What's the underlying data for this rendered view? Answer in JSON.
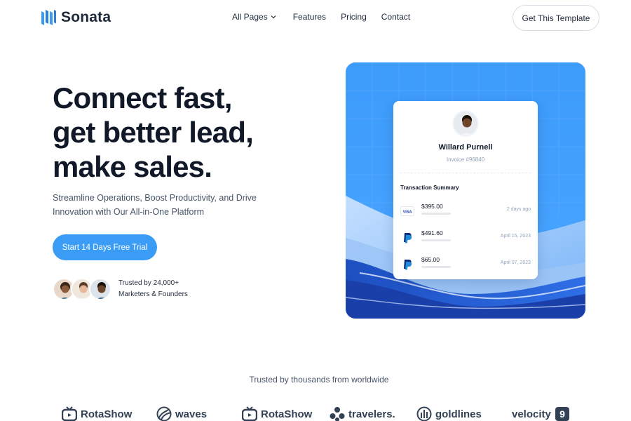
{
  "brand": {
    "name": "Sonata",
    "accent": "#3b9cf5"
  },
  "nav": {
    "links": [
      {
        "label": "All Pages",
        "has_dropdown": true
      },
      {
        "label": "Features"
      },
      {
        "label": "Pricing"
      },
      {
        "label": "Contact"
      }
    ],
    "cta": "Get This Template"
  },
  "hero": {
    "headline": [
      "Connect fast,",
      "get better lead,",
      "make sales."
    ],
    "subtext": [
      "Streamline Operations, Boost Productivity, and Drive",
      "Innovation with Our All-in-One Platform"
    ],
    "cta": "Start 14 Days Free Trial",
    "trust": [
      "Trusted by 24,000+",
      "Marketers & Founders"
    ]
  },
  "card": {
    "name": "Willard Purnell",
    "invoice": "Invoice #96840",
    "section_title": "Transaction Summary",
    "transactions": [
      {
        "method_icon": "visa-icon",
        "amount": "$395.00",
        "date": "2 days ago"
      },
      {
        "method_icon": "paypal-icon",
        "amount": "$491.60",
        "date": "April 15, 2023"
      },
      {
        "method_icon": "paypal-icon",
        "amount": "$65.00",
        "date": "April 07, 2023"
      }
    ],
    "visa_text": "VISA"
  },
  "trusted": {
    "title": "Trusted by thousands from worldwide",
    "brands": [
      {
        "name": "RotaShow",
        "icon": "tv-icon"
      },
      {
        "name": "waves",
        "icon": "globe-icon"
      },
      {
        "name": "RotaShow",
        "icon": "tv-icon"
      },
      {
        "name": "travelers.",
        "icon": "flower-icon"
      },
      {
        "name": "goldlines",
        "icon": "bars-icon"
      },
      {
        "name": "velocity",
        "icon": "number-badge-icon",
        "badge": "9"
      }
    ]
  }
}
